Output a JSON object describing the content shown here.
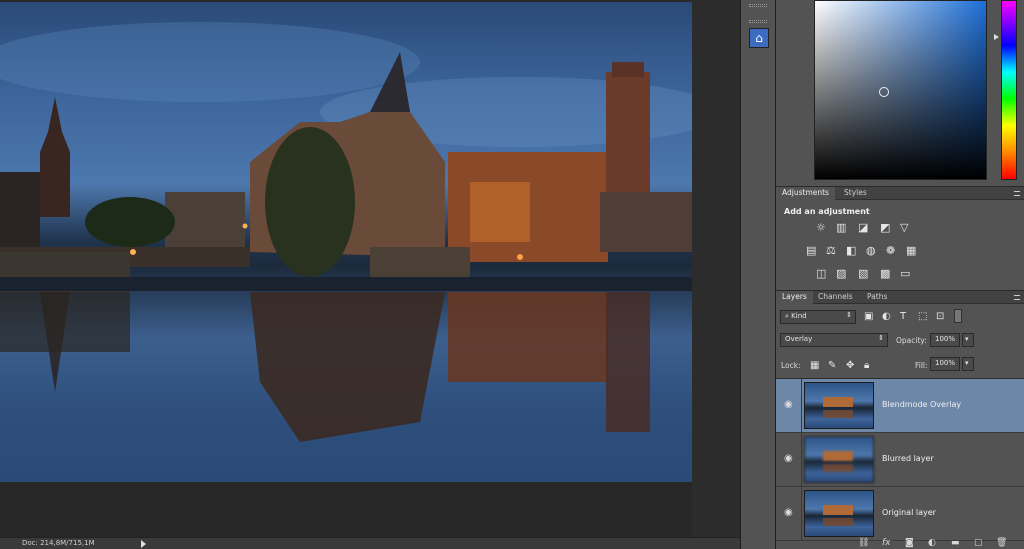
{
  "status": {
    "doc_info": "Doc: 214,8M/715,1M"
  },
  "panels": {
    "adjustments": {
      "tabs": [
        "Adjustments",
        "Styles"
      ],
      "heading": "Add an adjustment",
      "icons_row1": [
        "brightness-icon",
        "levels-icon",
        "curves-icon",
        "exposure-icon",
        "vibrance-icon"
      ],
      "icons_row2": [
        "hue-saturation-icon",
        "color-balance-icon",
        "black-white-icon",
        "photo-filter-icon",
        "channel-mixer-icon",
        "color-lookup-icon"
      ],
      "icons_row3": [
        "invert-icon",
        "posterize-icon",
        "threshold-icon",
        "selective-color-icon",
        "gradient-map-icon"
      ]
    },
    "layers": {
      "tabs": [
        "Layers",
        "Channels",
        "Paths"
      ],
      "filter_kind": "Kind",
      "blend_mode": "Overlay",
      "opacity_label": "Opacity:",
      "opacity_value": "100%",
      "lock_label": "Lock:",
      "fill_label": "Fill:",
      "fill_value": "100%",
      "items": [
        {
          "name": "Blendmode Overlay",
          "selected": true
        },
        {
          "name": "Blurred layer",
          "selected": false
        },
        {
          "name": "Original layer",
          "selected": false
        }
      ],
      "footer_icons": [
        "link-icon",
        "fx-icon",
        "mask-icon",
        "adjustment-layer-icon",
        "group-icon",
        "new-layer-icon",
        "trash-icon"
      ]
    }
  },
  "colors": {
    "selected_row": "#6d87a8",
    "panel_bg": "#535353"
  }
}
